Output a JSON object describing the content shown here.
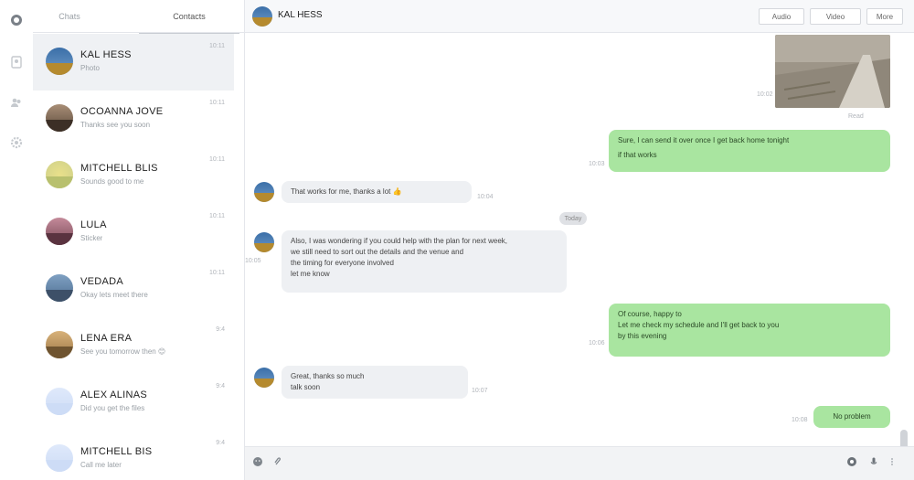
{
  "rail": {
    "items": [
      {
        "icon": "chat-bubble-icon"
      },
      {
        "icon": "contacts-icon"
      },
      {
        "icon": "groups-icon"
      },
      {
        "icon": "settings-gear-icon"
      }
    ]
  },
  "list_tabs": [
    {
      "label": "Chats"
    },
    {
      "label": "Contacts"
    }
  ],
  "conversations": [
    {
      "name": "KAL HESS",
      "preview": "Photo",
      "time": "10:11",
      "active": true,
      "avatar": "landscape"
    },
    {
      "name": "OCOANNA JOVE",
      "preview": "Thanks see you soon",
      "time": "10:11",
      "active": false,
      "avatar": "portrait-dark"
    },
    {
      "name": "MITCHELL BLIS",
      "preview": "Sounds good to me",
      "time": "10:11",
      "active": false,
      "avatar": "flower"
    },
    {
      "name": "LULA",
      "preview": "Sticker",
      "time": "10:11",
      "active": false,
      "avatar": "portrait-pink"
    },
    {
      "name": "VEDADA",
      "preview": "Okay lets meet there",
      "time": "10:11",
      "active": false,
      "avatar": "city"
    },
    {
      "name": "LENA ERA",
      "preview": "See you tomorrow then 😊",
      "time": "9:4",
      "active": false,
      "avatar": "portrait-warm"
    },
    {
      "name": "ALEX ALINAS",
      "preview": "Did you get the files",
      "time": "9:4",
      "active": false,
      "avatar": "placeholder"
    },
    {
      "name": "MITCHELL BIS",
      "preview": "Call me later",
      "time": "9:4",
      "active": false,
      "avatar": "placeholder"
    }
  ],
  "chat": {
    "contact_name": "KAL HESS",
    "header_buttons": [
      "Audio",
      "Video",
      "More"
    ],
    "messages": [
      {
        "dir": "out",
        "kind": "photo",
        "status": "Read",
        "time": "10:02"
      },
      {
        "dir": "out",
        "text": "Sure, I can send it over once I get back home tonight",
        "text2": "if that works",
        "time": "10:03"
      },
      {
        "dir": "in",
        "text": "That works for me, thanks a lot 👍",
        "time": "10:04"
      },
      {
        "dir": "in",
        "kind": "date",
        "text": "Today"
      },
      {
        "dir": "in",
        "text": "Also, I was wondering if you could help with the plan for next week,",
        "text2": "we still need to sort out the details and the venue and",
        "text3": "the timing for everyone involved",
        "text4": "let me know",
        "time": "10:05"
      },
      {
        "dir": "out",
        "text": "Of course, happy to",
        "text2": "Let me check my schedule and I'll get back to you",
        "text3": "by this evening",
        "time": "10:06"
      },
      {
        "dir": "in",
        "text": "Great, thanks so much",
        "text2": "talk soon",
        "time": "10:07"
      },
      {
        "dir": "out",
        "text": "No problem",
        "time": "10:08"
      }
    ]
  },
  "composer": {
    "icons": [
      "emoji-icon",
      "attach-icon",
      "emoji-icon-right",
      "mic-icon",
      "more-icon"
    ]
  },
  "colors": {
    "accent_out": "#a9e5a0",
    "bubble_in": "#eef0f3",
    "active_row": "#eff1f4"
  }
}
